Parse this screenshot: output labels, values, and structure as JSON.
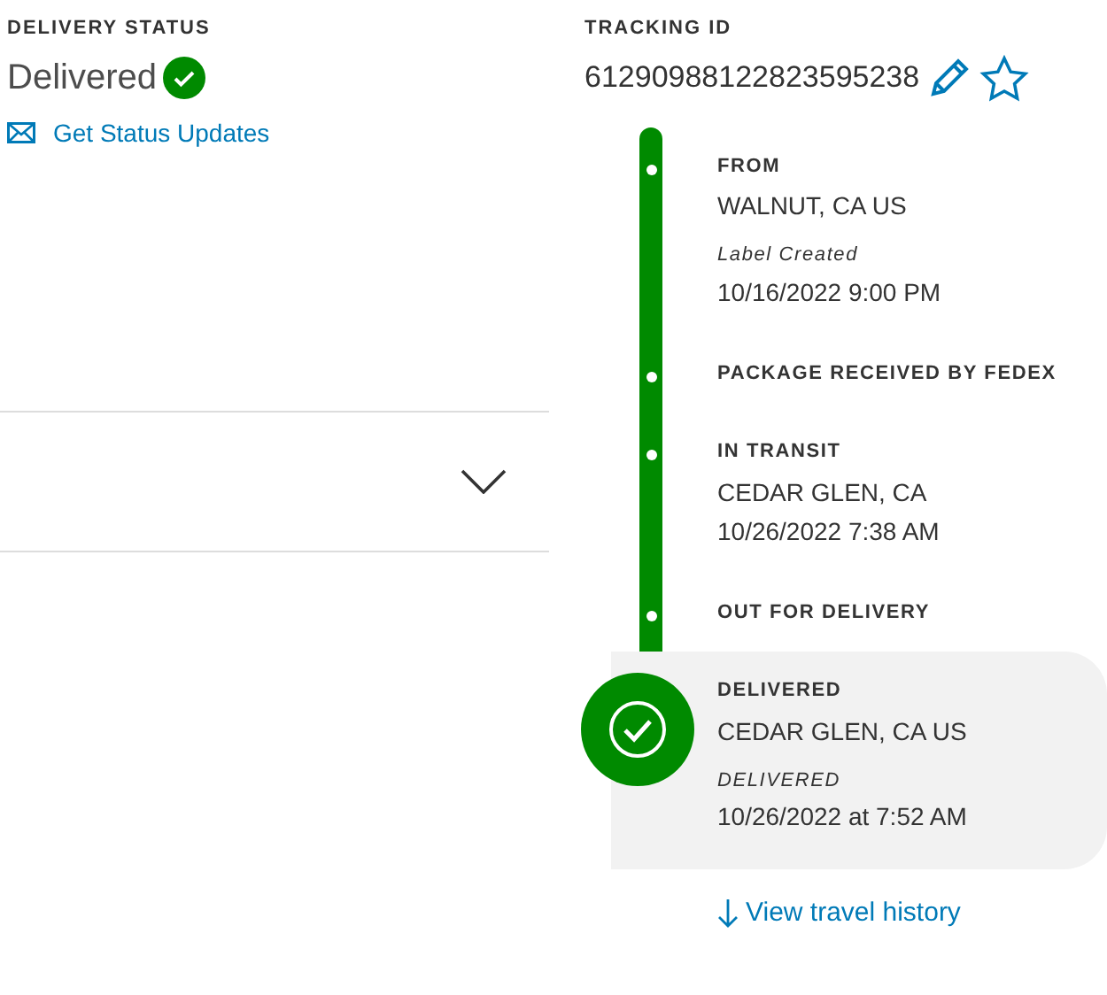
{
  "delivery_status": {
    "label": "DELIVERY STATUS",
    "status": "Delivered",
    "delivered": true,
    "updates_link": "Get Status Updates"
  },
  "details_panel": {
    "expanded": false
  },
  "tracking": {
    "label": "TRACKING ID",
    "number": "61290988122823595238",
    "starred": false
  },
  "timeline": {
    "steps": [
      {
        "title": "FROM",
        "location": "WALNUT, CA US",
        "note": "Label Created",
        "date": "10/16/2022 9:00 PM",
        "selected": false
      },
      {
        "title": "PACKAGE RECEIVED BY FEDEX",
        "selected": false
      },
      {
        "title": "IN TRANSIT",
        "location": "CEDAR GLEN, CA",
        "date": "10/26/2022 7:38 AM",
        "selected": false
      },
      {
        "title": "OUT FOR DELIVERY",
        "selected": false
      },
      {
        "title": "DELIVERED",
        "location": "CEDAR GLEN, CA US",
        "note": "DELIVERED",
        "date": "10/26/2022 at 7:52 AM",
        "selected": true
      }
    ],
    "history_link": "View travel history"
  }
}
